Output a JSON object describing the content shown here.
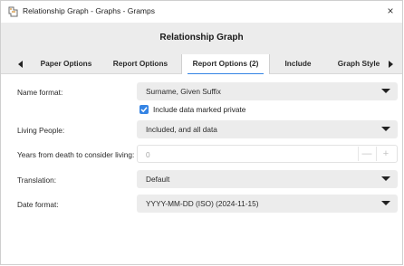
{
  "window": {
    "title": "Relationship Graph - Graphs - Gramps",
    "close": "×"
  },
  "dialog": {
    "title": "Relationship Graph"
  },
  "tabs": [
    {
      "label": "Paper Options"
    },
    {
      "label": "Report Options"
    },
    {
      "label": "Report Options (2)",
      "active": true
    },
    {
      "label": "Include"
    },
    {
      "label": "Graph Style"
    }
  ],
  "form": {
    "name_format": {
      "label": "Name format:",
      "value": "Surname, Given Suffix"
    },
    "include_private": {
      "label": "Include data marked private",
      "checked": true
    },
    "living_people": {
      "label": "Living People:",
      "value": "Included, and all data"
    },
    "years_from_death": {
      "label": "Years from death to consider living:",
      "value": "0",
      "minus": "—",
      "plus": "+"
    },
    "translation": {
      "label": "Translation:",
      "value": "Default"
    },
    "date_format": {
      "label": "Date format:",
      "value": "YYYY-MM-DD (ISO) (2024-11-15)"
    }
  },
  "colors": {
    "accent": "#3584e4",
    "header_bg": "#ececec"
  }
}
